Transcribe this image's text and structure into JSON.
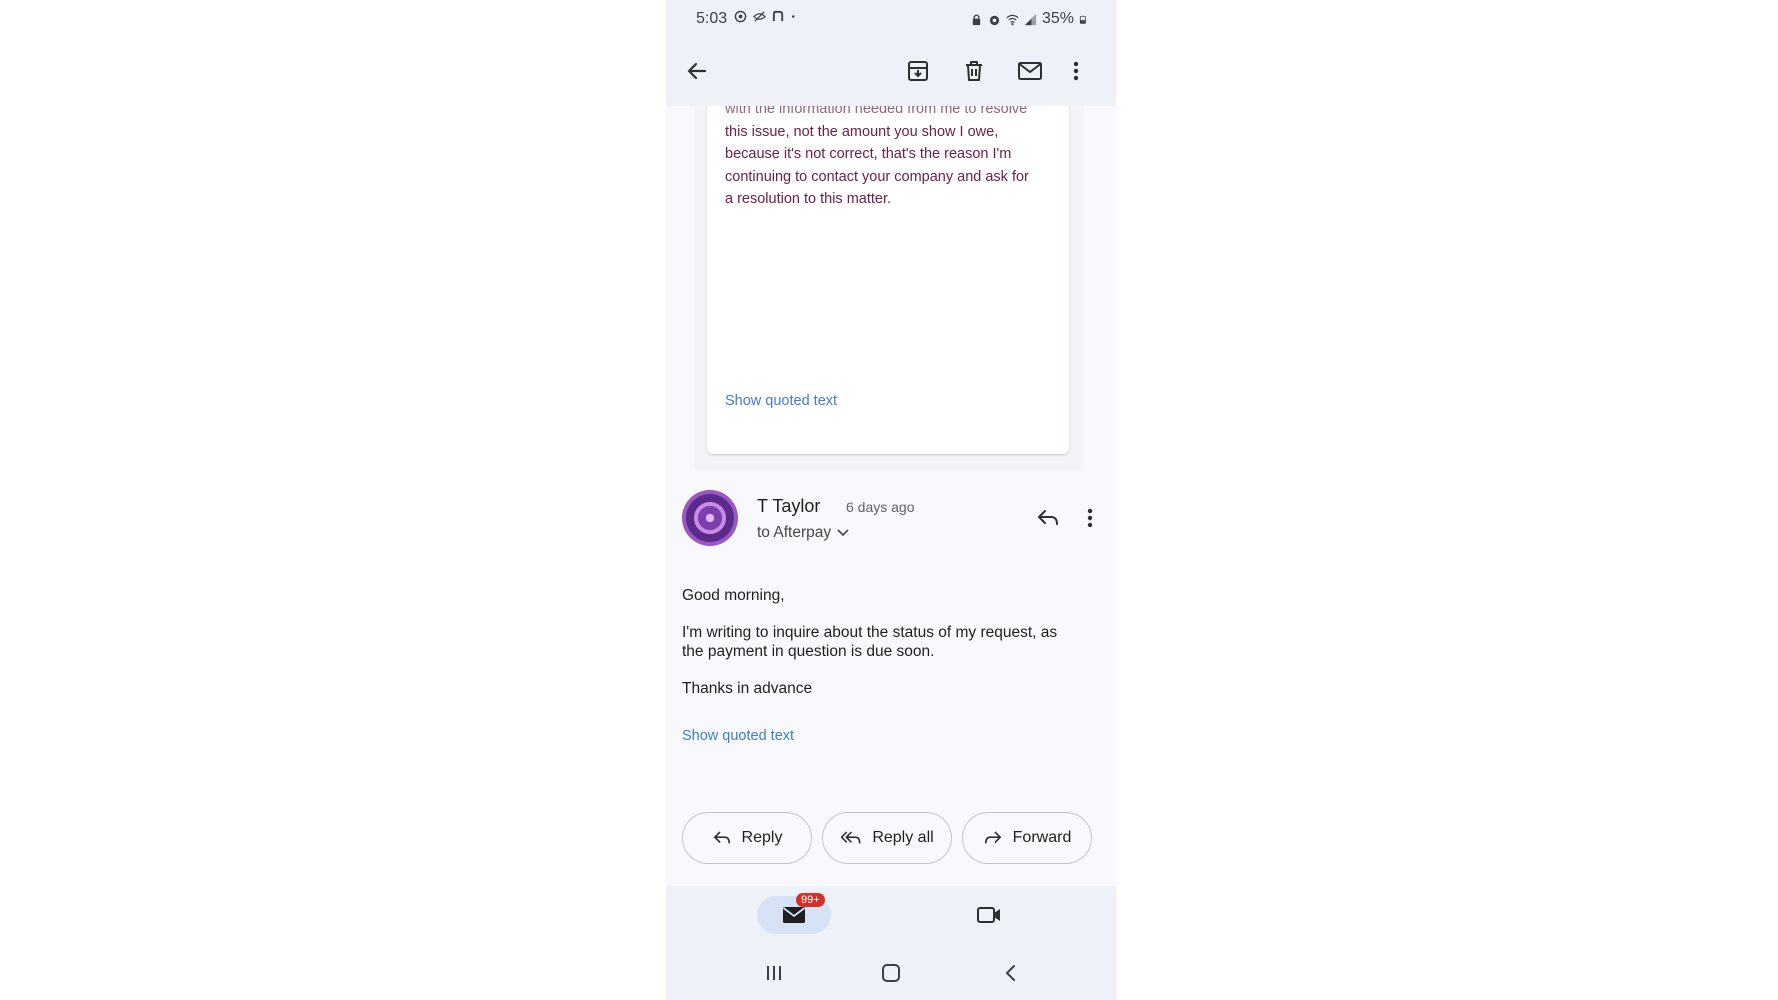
{
  "status_bar": {
    "time": "5:03",
    "battery": "35%"
  },
  "top_bar": {
    "icons": [
      "back-arrow-icon",
      "archive-icon",
      "delete-icon",
      "mark-unread-icon",
      "more-vert-icon"
    ]
  },
  "quoted_message": {
    "first_line": "with the information needed from me to resolve",
    "lines": [
      "this issue, not the amount you show I owe,",
      "because it's not correct,  that's the reason I'm",
      "continuing to contact your company and ask for",
      "a resolution to this matter."
    ],
    "show_quoted": "Show quoted text"
  },
  "message": {
    "sender": "T Taylor",
    "time_ago": "6 days ago",
    "recipient": "to Afterpay",
    "body": [
      "Good morning,",
      "I'm writing to inquire about the status of my request, as the payment in question is due soon.",
      "Thanks in advance"
    ],
    "show_quoted": "Show quoted text"
  },
  "actions": {
    "reply": "Reply",
    "reply_all": "Reply all",
    "forward": "Forward"
  },
  "bottom_nav": {
    "mail_badge": "99+"
  },
  "colors": {
    "link": "#3f7ecb",
    "quoted_text": "#6a2148",
    "badge": "#d3312b",
    "bar_background": "#eef1f7"
  }
}
